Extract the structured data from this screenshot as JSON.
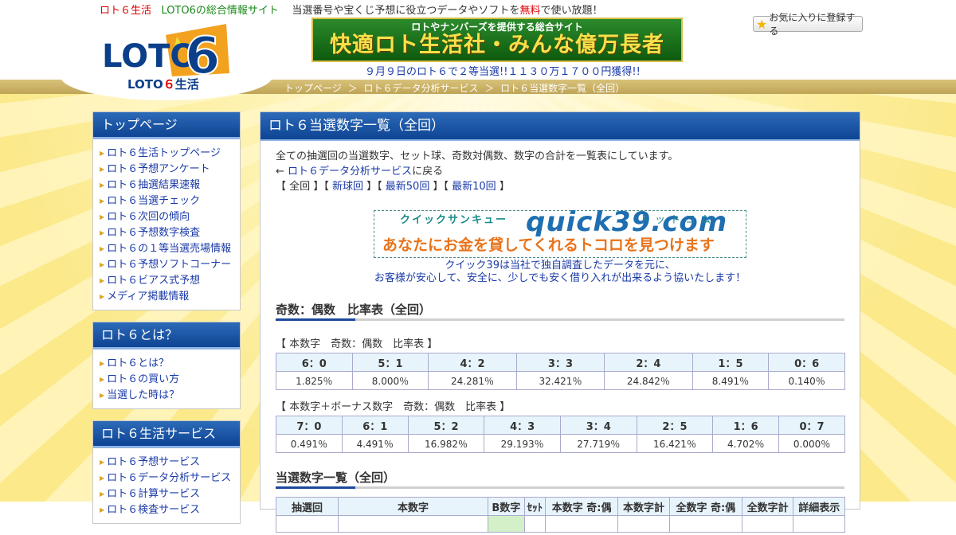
{
  "header": {
    "tag_site": "ロト６生活",
    "tag_sub": "LOTO6の総合情報サイト",
    "tag_desc_pre": "当選番号や宝くじ予想に役立つデータやソフトを",
    "tag_free": "無料",
    "tag_desc_post": "で使い放題！",
    "logo_text": "LOTO",
    "logo_number": "6",
    "logo_sub_pre": "LOTO",
    "logo_sub_six": "６",
    "logo_sub_post": "生活",
    "banner_top": "ロトやナンバーズを提供する総合サイト",
    "banner_main": "快適ロト生活社・みんな億万長者",
    "news": "９月９日のロト６で２等当選!!１１３０万１７００円獲得!!",
    "fav_label": "お気に入りに登録する"
  },
  "breadcrumb": [
    "トップページ",
    "＞",
    "ロト６データ分析サービス",
    "＞",
    "ロト６当選数字一覧（全回）"
  ],
  "sidebar": {
    "sections": [
      {
        "title": "トップページ",
        "items": [
          "ロト６生活トップページ",
          "ロト６予想アンケート",
          "ロト６抽選結果速報",
          "ロト６当選チェック",
          "ロト６次回の傾向",
          "ロト６予想数字検査",
          "ロト６の１等当選売場情報",
          "ロト６予想ソフトコーナー",
          "ロト６ビアス式予想",
          "メディア掲載情報"
        ]
      },
      {
        "title": "ロト６とは？",
        "items": [
          "ロト６とは？",
          "ロト６の買い方",
          "当選した時は？"
        ]
      },
      {
        "title": "ロト６生活サービス",
        "items": [
          "ロト６予想サービス",
          "ロト６データ分析サービス",
          "ロト６計算サービス",
          "ロト６検査サービス"
        ]
      }
    ]
  },
  "main": {
    "title": "ロト６当選数字一覧（全回）",
    "intro": "全ての抽選回の当選数字、セット球、奇数対偶数、数字の合計を一覧表にしています。",
    "back_arrow": "←",
    "back_link": "ロト６データ分析サービス",
    "back_suffix": "に戻る",
    "filters": [
      "【",
      "全回",
      "】【",
      "新球回",
      "】【",
      "最新50回",
      "】【",
      "最新10回",
      "】"
    ],
    "ad": {
      "kana_left": "クイックサンキュー",
      "kana_right": "ドットコム",
      "big": "quick39.com",
      "headline": "あなたにお金を貸してくれるトコロを見つけます",
      "line1": "クイック39は当社で独自調査したデータを元に、",
      "line2": "お客様が安心して、安全に、少しでも安く借り入れが出来るよう協いたします！"
    },
    "ratio_section_title": "奇数：偶数　比率表（全回）",
    "table1": {
      "caption": "【 本数字　奇数：偶数　比率表 】",
      "headers": [
        "6：0",
        "5：1",
        "4：2",
        "3：3",
        "2：4",
        "1：5",
        "0：6"
      ],
      "values": [
        "1.825％",
        "8.000％",
        "24.281％",
        "32.421％",
        "24.842％",
        "8.491％",
        "0.140％"
      ]
    },
    "table2": {
      "caption": "【 本数字＋ボーナス数字　奇数：偶数　比率表 】",
      "headers": [
        "7：0",
        "6：1",
        "5：2",
        "4：3",
        "3：4",
        "2：5",
        "1：6",
        "0：7"
      ],
      "values": [
        "0.491％",
        "4.491％",
        "16.982％",
        "29.193％",
        "27.719％",
        "16.421％",
        "4.702％",
        "0.000％"
      ]
    },
    "list_section_title": "当選数字一覧（全回）",
    "list_headers": [
      "抽選回",
      "本数字",
      "B数字",
      "ｾｯﾄ",
      "本数字 奇:偶",
      "本数字計",
      "全数字 奇:偶",
      "全数字計",
      "詳細表示"
    ]
  }
}
